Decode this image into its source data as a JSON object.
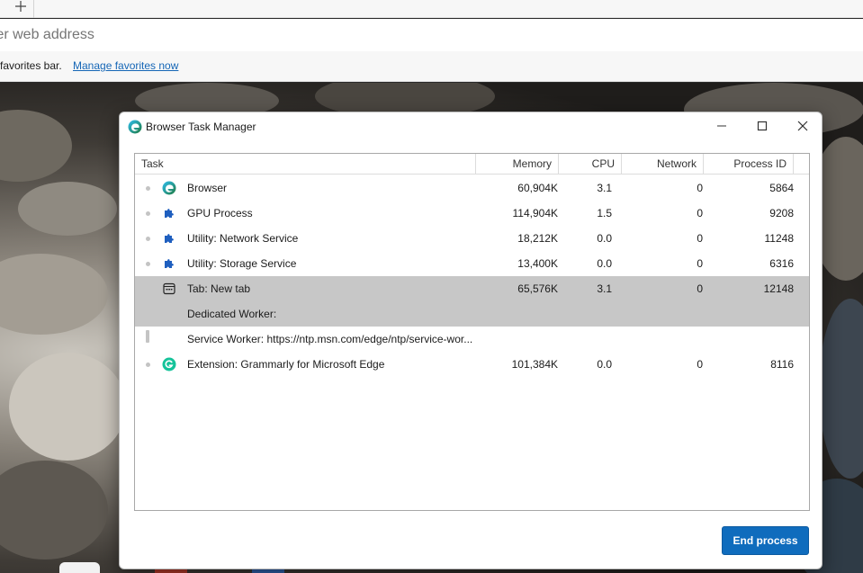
{
  "browser": {
    "new_tab_icon": "plus-icon",
    "address_placeholder": "ter web address",
    "favorites_text": "favorites bar.",
    "favorites_link": "Manage favorites now"
  },
  "dialog": {
    "title": "Browser Task Manager",
    "app_icon": "edge-icon",
    "end_button": "End process",
    "accent_color": "#0f6cbd"
  },
  "columns": {
    "task": "Task",
    "memory": "Memory",
    "cpu": "CPU",
    "network": "Network",
    "pid": "Process ID"
  },
  "rows": [
    {
      "icon": "edge-icon",
      "name": "Browser",
      "memory": "60,904K",
      "cpu": "3.1",
      "network": "0",
      "pid": "5864"
    },
    {
      "icon": "puzzle-icon",
      "name": "GPU Process",
      "memory": "114,904K",
      "cpu": "1.5",
      "network": "0",
      "pid": "9208"
    },
    {
      "icon": "puzzle-icon",
      "name": "Utility: Network Service",
      "memory": "18,212K",
      "cpu": "0.0",
      "network": "0",
      "pid": "11248"
    },
    {
      "icon": "puzzle-icon",
      "name": "Utility: Storage Service",
      "memory": "13,400K",
      "cpu": "0.0",
      "network": "0",
      "pid": "6316"
    },
    {
      "icon": "tab-icon",
      "name": "Tab: New tab",
      "memory": "65,576K",
      "cpu": "3.1",
      "network": "0",
      "pid": "12148",
      "selected": true
    },
    {
      "icon": "",
      "name": "Dedicated Worker:",
      "memory": "",
      "cpu": "",
      "network": "",
      "pid": "",
      "selected": true
    },
    {
      "icon": "",
      "name": "Service Worker: https://ntp.msn.com/edge/ntp/service-wor...",
      "memory": "",
      "cpu": "",
      "network": "",
      "pid": ""
    },
    {
      "icon": "grammarly-icon",
      "name": "Extension: Grammarly for Microsoft Edge",
      "memory": "101,384K",
      "cpu": "0.0",
      "network": "0",
      "pid": "8116"
    }
  ]
}
